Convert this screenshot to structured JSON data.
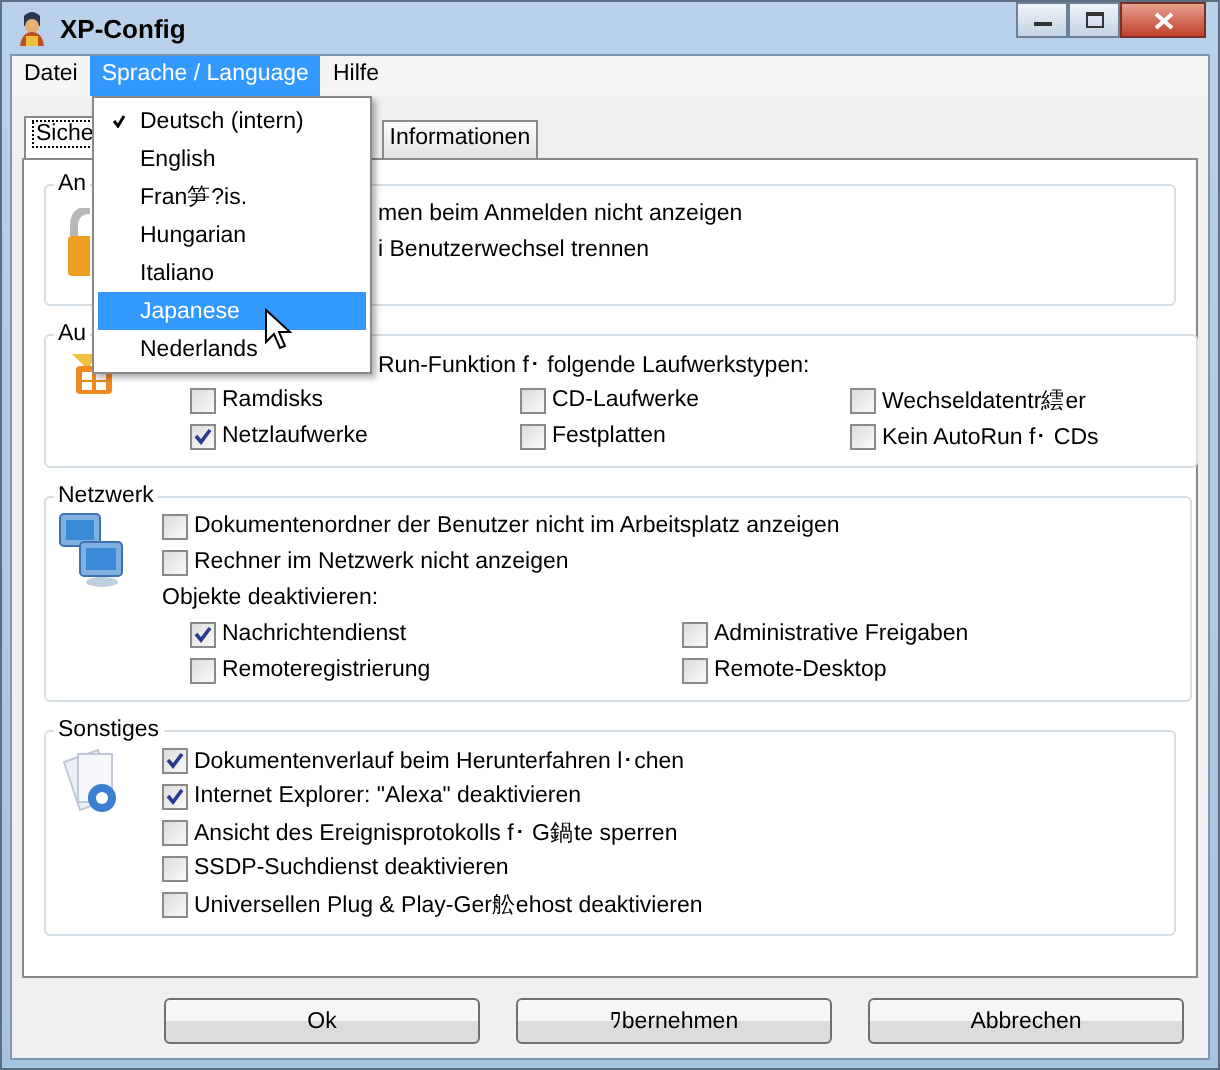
{
  "window": {
    "title": "XP-Config"
  },
  "menu_bar": [
    {
      "label": "Datei",
      "selected": false
    },
    {
      "label": "Sprache / Language",
      "selected": true
    },
    {
      "label": "Hilfe",
      "selected": false
    }
  ],
  "language_menu": [
    {
      "label": "Deutsch (intern)",
      "checked": true,
      "selected": false
    },
    {
      "label": "English",
      "checked": false,
      "selected": false
    },
    {
      "label": "Fran笋?is.",
      "checked": false,
      "selected": false
    },
    {
      "label": "Hungarian",
      "checked": false,
      "selected": false
    },
    {
      "label": "Italiano",
      "checked": false,
      "selected": false
    },
    {
      "label": "Japanese",
      "checked": false,
      "selected": true
    },
    {
      "label": "Nederlands",
      "checked": false,
      "selected": false
    }
  ],
  "tabs": [
    {
      "label": "Siche",
      "selected": true
    },
    {
      "label": "Informationen",
      "selected": false
    }
  ],
  "groups": [
    {
      "legend": "An",
      "items": [
        {
          "kind": "covered",
          "label": "men beim Anmelden nicht anzeigen"
        },
        {
          "kind": "covered",
          "label": "i Benutzerwechsel trennen"
        }
      ]
    },
    {
      "legend": "Au",
      "items": [
        {
          "kind": "covered",
          "label": "Run-Funktion f･ folgende Laufwerkstypen:"
        },
        {
          "kind": "grid",
          "rows": [
            [
              {
                "label": "Ramdisks",
                "checked": false
              },
              {
                "label": "CD-Laufwerke",
                "checked": false
              },
              {
                "label": "Wechseldatentr繧er",
                "checked": false
              }
            ],
            [
              {
                "label": "Netzlaufwerke",
                "checked": true
              },
              {
                "label": "Festplatten",
                "checked": false
              },
              {
                "label": "Kein AutoRun f･ CDs",
                "checked": false
              }
            ]
          ]
        }
      ]
    },
    {
      "legend": "Netzwerk",
      "items": [
        {
          "kind": "check",
          "label": "Dokumentenordner der Benutzer nicht im Arbeitsplatz anzeigen",
          "checked": false
        },
        {
          "kind": "check",
          "label": "Rechner im Netzwerk nicht anzeigen",
          "checked": false
        },
        {
          "kind": "caption",
          "label": "Objekte deaktivieren:"
        },
        {
          "kind": "grid",
          "rows": [
            [
              {
                "label": "Nachrichtendienst",
                "checked": true
              },
              {
                "label": "Administrative Freigaben",
                "checked": false
              }
            ],
            [
              {
                "label": "Remoteregistrierung",
                "checked": false
              },
              {
                "label": "Remote-Desktop",
                "checked": false
              }
            ]
          ]
        }
      ]
    },
    {
      "legend": "Sonstiges",
      "items": [
        {
          "kind": "check",
          "label": "Dokumentenverlauf beim Herunterfahren l･chen",
          "checked": true
        },
        {
          "kind": "check",
          "label": "Internet Explorer: \"Alexa\" deaktivieren",
          "checked": true
        },
        {
          "kind": "check",
          "label": "Ansicht des Ereignisprotokolls f･ G鍋te sperren",
          "checked": false
        },
        {
          "kind": "check",
          "label": "SSDP-Suchdienst deaktivieren",
          "checked": false
        },
        {
          "kind": "check",
          "label": "Universellen Plug & Play-Ger舩ehost deaktivieren",
          "checked": false
        }
      ]
    }
  ],
  "buttons": [
    "Ok",
    "ﾜbernehmen",
    "Abbrechen"
  ]
}
